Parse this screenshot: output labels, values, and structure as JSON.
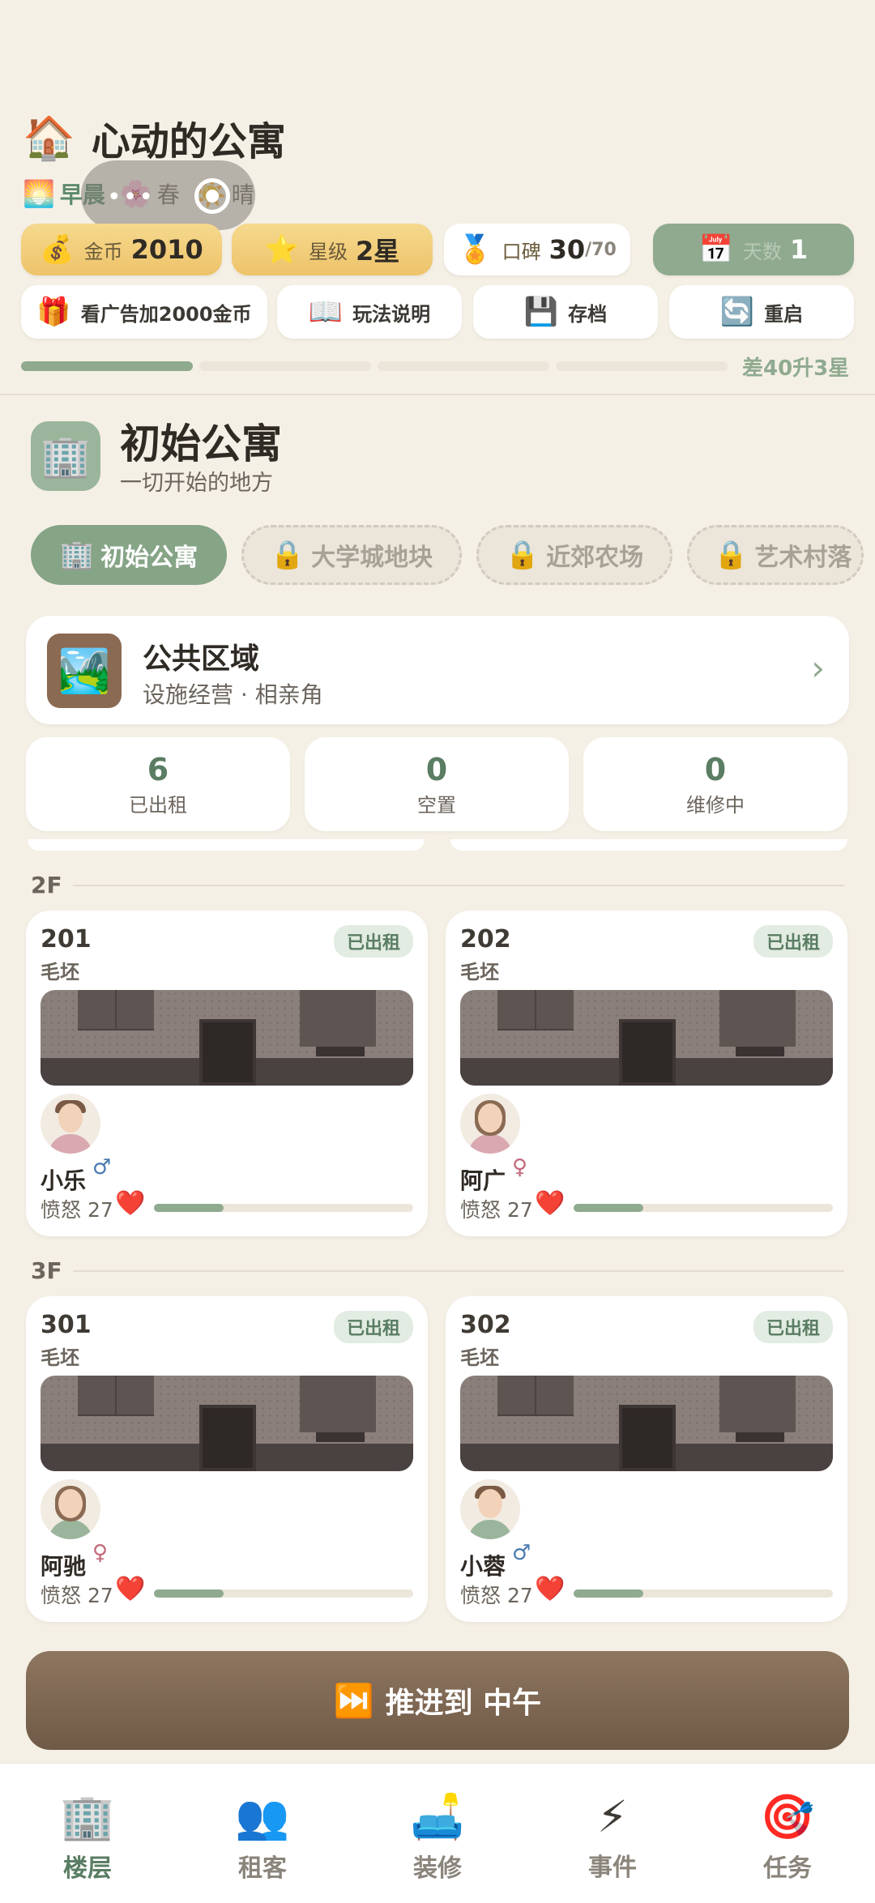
{
  "header": {
    "icon": "house-icon",
    "title": "心动的公寓",
    "time_of_day": "早晨",
    "season": "春",
    "weather": "晴",
    "overlay_dots": "•••"
  },
  "stats": {
    "gold_label": "金币",
    "gold_value": "2010",
    "star_label": "星级",
    "star_value": "2星",
    "reputation_label": "口碑",
    "reputation_value": "30",
    "reputation_max": "/70",
    "day_label": "天数",
    "day_value": "1"
  },
  "actions": {
    "ad_label": "看广告加2000金币",
    "help_label": "玩法说明",
    "save_label": "存档",
    "restart_label": "重启"
  },
  "progress": {
    "filled_segments": 1,
    "total_segments": 4,
    "text": "差40升3星"
  },
  "building": {
    "name": "初始公寓",
    "desc": "一切开始的地方",
    "tabs": [
      {
        "label": "初始公寓",
        "locked": false
      },
      {
        "label": "大学城地块",
        "locked": true
      },
      {
        "label": "近郊农场",
        "locked": true
      },
      {
        "label": "艺术村落",
        "locked": true
      }
    ]
  },
  "public_area": {
    "title": "公共区域",
    "subtitle": "设施经营 · 相亲角",
    "arrow": "›"
  },
  "counts": [
    {
      "value": "6",
      "label": "已出租"
    },
    {
      "value": "0",
      "label": "空置"
    },
    {
      "value": "0",
      "label": "维修中"
    }
  ],
  "floors": [
    {
      "label": "2F",
      "rooms": [
        {
          "number": "201",
          "kind": "毛坯",
          "status": "已出租",
          "tenant": "小乐",
          "gender": "♂",
          "mood": "愤怒",
          "age": "27",
          "mood_level": 0.27
        },
        {
          "number": "202",
          "kind": "毛坯",
          "status": "已出租",
          "tenant": "阿广",
          "gender": "♀",
          "mood": "愤怒",
          "age": "27",
          "mood_level": 0.27
        }
      ]
    },
    {
      "label": "3F",
      "rooms": [
        {
          "number": "301",
          "kind": "毛坯",
          "status": "已出租",
          "tenant": "阿驰",
          "gender": "♀",
          "mood": "愤怒",
          "age": "27",
          "mood_level": 0.27
        },
        {
          "number": "302",
          "kind": "毛坯",
          "status": "已出租",
          "tenant": "小蓉",
          "gender": "♂",
          "mood": "愤怒",
          "age": "27",
          "mood_level": 0.27
        }
      ]
    }
  ],
  "advance": {
    "label": "推进到 中午"
  },
  "nav": [
    {
      "label": "楼层",
      "icon": "building-icon",
      "active": true
    },
    {
      "label": "租客",
      "icon": "people-icon",
      "active": false
    },
    {
      "label": "装修",
      "icon": "sofa-icon",
      "active": false
    },
    {
      "label": "事件",
      "icon": "lightning-icon",
      "active": false
    },
    {
      "label": "任务",
      "icon": "target-icon",
      "active": false
    }
  ],
  "colors": {
    "accent": "#8faa8f",
    "gold": "#eec36a",
    "brown": "#7a6350",
    "background": "#f5f0e6"
  }
}
